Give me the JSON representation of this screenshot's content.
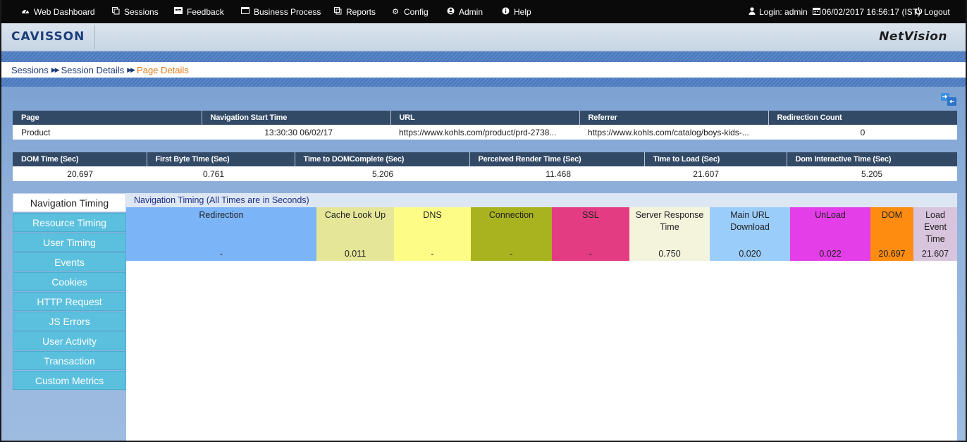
{
  "topnav": {
    "items": [
      {
        "label": "Web Dashboard",
        "icon": "dashboard-icon"
      },
      {
        "label": "Sessions",
        "icon": "sessions-icon"
      },
      {
        "label": "Feedback",
        "icon": "feedback-icon"
      },
      {
        "label": "Business Process",
        "icon": "business-process-icon"
      },
      {
        "label": "Reports",
        "icon": "reports-icon"
      },
      {
        "label": "Config",
        "icon": "config-icon"
      },
      {
        "label": "Admin",
        "icon": "admin-icon"
      },
      {
        "label": "Help",
        "icon": "help-icon"
      }
    ],
    "login": "Login: admin",
    "datetime": "06/02/2017 16:56:17 (IST)",
    "logout": "Logout"
  },
  "brand": {
    "logo_text": "CAVISSON",
    "product": "NetVision"
  },
  "breadcrumb": {
    "sessions": "Sessions",
    "session_details": "Session Details",
    "current": "Page Details"
  },
  "page_table": {
    "headers": [
      "Page",
      "Navigation Start Time",
      "URL",
      "Referrer",
      "Redirection Count"
    ],
    "row": [
      "Product",
      "13:30:30 06/02/17",
      "https://www.kohls.com/product/prd-2738...",
      "https://www.kohls.com/catalog/boys-kids-...",
      "0"
    ]
  },
  "metrics_table": {
    "headers": [
      "DOM Time (Sec)",
      "First Byte Time (Sec)",
      "Time to DOMComplete (Sec)",
      "Perceived Render Time (Sec)",
      "Time to Load (Sec)",
      "Dom Interactive Time (Sec)"
    ],
    "row": [
      "20.697",
      "0.761",
      "5.206",
      "11.468",
      "21.607",
      "5.205"
    ]
  },
  "tabs": [
    "Navigation Timing",
    "Resource Timing",
    "User Timing",
    "Events",
    "Cookies",
    "HTTP Request",
    "JS Errors",
    "User Activity",
    "Transaction",
    "Custom Metrics"
  ],
  "active_tab": "Navigation Timing",
  "panel": {
    "title": "Navigation Timing (All Times are in Seconds)",
    "columns": [
      {
        "label": "Redirection",
        "value": "-",
        "color": "#7cb5f7"
      },
      {
        "label": "Cache Look Up",
        "value": "0.011",
        "color": "#e6e699"
      },
      {
        "label": "DNS",
        "value": "-",
        "color": "#fdfc86"
      },
      {
        "label": "Connection",
        "value": "-",
        "color": "#a9b320"
      },
      {
        "label": "SSL",
        "value": "-",
        "color": "#e43c83"
      },
      {
        "label": "Server Response Time",
        "value": "0.750",
        "color": "#f4f4dd"
      },
      {
        "label": "Main URL Download",
        "value": "0.020",
        "color": "#9bcdfa"
      },
      {
        "label": "UnLoad",
        "value": "0.022",
        "color": "#e33ee8"
      },
      {
        "label": "DOM",
        "value": "20.697",
        "color": "#fd8c10"
      },
      {
        "label": "Load Event Time",
        "value": "21.607",
        "color": "#d8c4dd"
      }
    ]
  }
}
